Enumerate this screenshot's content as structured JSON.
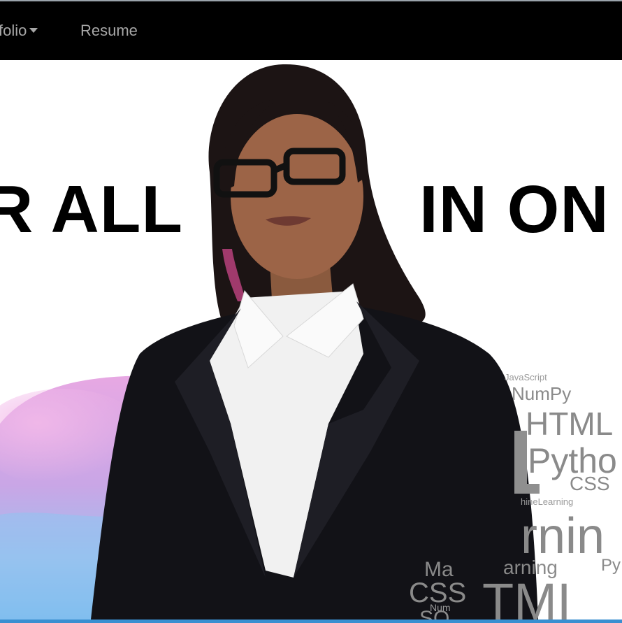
{
  "nav": {
    "portfolio_label": "folio",
    "resume_label": "Resume"
  },
  "hero": {
    "headline_left": "R ALL",
    "headline_right": "IN ON",
    "word_cloud": [
      "JavaScript",
      "NumPy",
      "HTML",
      "Pytho",
      "CSS",
      "hineLearning",
      "rnin",
      "arning",
      "Py",
      "Ma",
      "CSS",
      "TMI",
      "Num",
      "SQ"
    ]
  },
  "colors": {
    "navbar": "#000000",
    "nav_text": "#a7a7a7",
    "headline": "#000000",
    "bottom_accent": "#3a8fd1",
    "word_cloud": "#8a8a8a"
  },
  "icons": [
    "caret-down-icon"
  ]
}
